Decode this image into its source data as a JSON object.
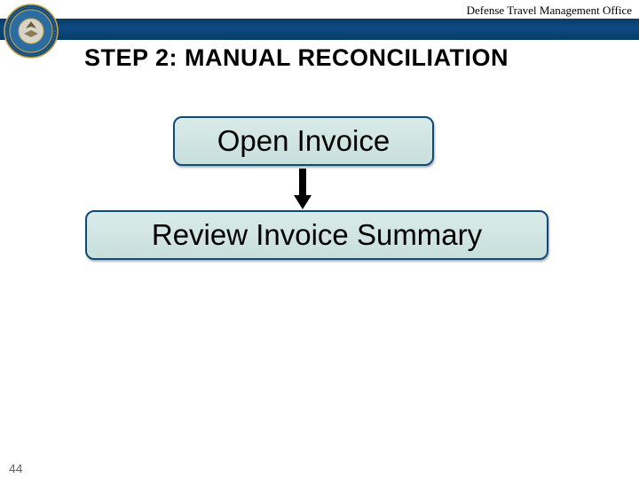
{
  "header": {
    "office": "Defense Travel Management Office"
  },
  "title": "STEP 2: MANUAL RECONCILIATION",
  "flow": {
    "step1": "Open Invoice",
    "step2": "Review Invoice Summary"
  },
  "page_number": "44",
  "seal": {
    "alt": "Department of Defense Seal"
  }
}
